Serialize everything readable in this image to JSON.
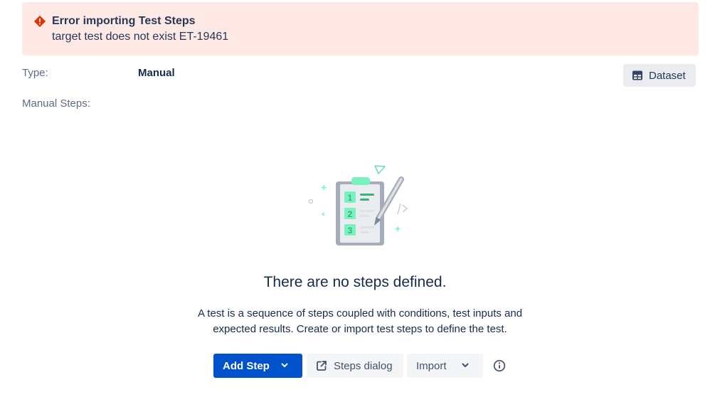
{
  "error": {
    "title": "Error importing Test Steps",
    "message": "target test does not exist ET-19461",
    "icon": "error-icon",
    "color": "#de350b"
  },
  "fields": {
    "type_label": "Type:",
    "type_value": "Manual",
    "manual_steps_label": "Manual Steps:"
  },
  "dataset_button": {
    "label": "Dataset",
    "icon": "table-icon"
  },
  "empty_state": {
    "title": "There are no steps defined.",
    "description": "A test is a sequence of steps coupled with conditions, test inputs and expected results. Create or import test steps to define the test.",
    "illustration_numbers": [
      "1",
      "2",
      "3"
    ],
    "illustration_code_glyph": "/>"
  },
  "actions": {
    "add_step": "Add Step",
    "steps_dialog": "Steps dialog",
    "import": "Import"
  },
  "colors": {
    "primary": "#0052cc",
    "error_bg": "#ffe9e4",
    "accent_green": "#57d9a3"
  }
}
